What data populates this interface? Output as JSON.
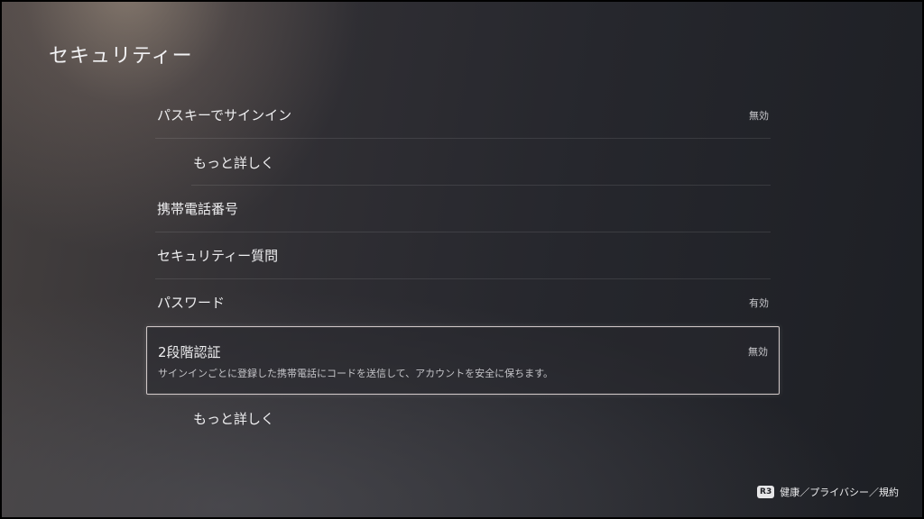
{
  "page": {
    "title": "セキュリティー"
  },
  "settings": {
    "passkey": {
      "label": "パスキーでサインイン",
      "value": "無効"
    },
    "passkey_more": {
      "label": "もっと詳しく"
    },
    "phone": {
      "label": "携帯電話番号"
    },
    "security_question": {
      "label": "セキュリティー質問"
    },
    "password": {
      "label": "パスワード",
      "value": "有効"
    },
    "two_step": {
      "label": "2段階認証",
      "value": "無効",
      "description": "サインインごとに登録した携帯電話にコードを送信して、アカウントを安全に保ちます。"
    },
    "two_step_more": {
      "label": "もっと詳しく"
    }
  },
  "footer": {
    "button_icon": "R3",
    "hint": "健康／プライバシー／規約"
  }
}
